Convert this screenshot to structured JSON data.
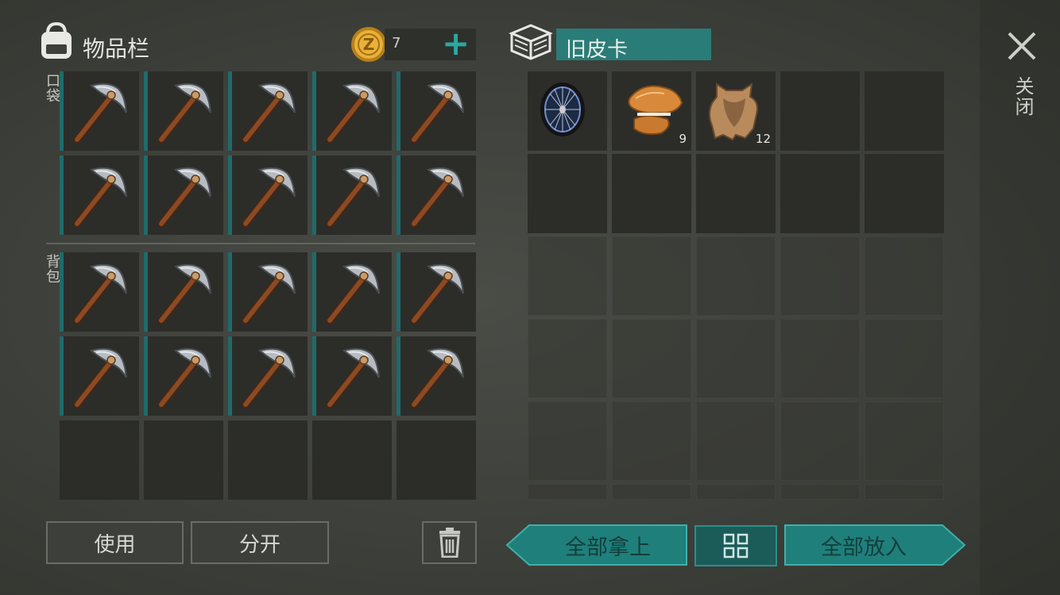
{
  "inventory": {
    "title": "物品栏",
    "pocket_label": "口袋",
    "backpack_label": "背包",
    "coin_count": "7",
    "add_symbol": "+",
    "item_name": "pickaxe"
  },
  "container": {
    "name": "旧皮卡",
    "items": [
      {
        "name": "wheel",
        "count": ""
      },
      {
        "name": "fox-fur",
        "count": "9"
      },
      {
        "name": "animal-hide",
        "count": "12"
      }
    ]
  },
  "actions": {
    "use_label": "使用",
    "split_label": "分开",
    "take_all_label": "全部拿上",
    "put_all_label": "全部放入",
    "close_label": "关闭"
  },
  "colors": {
    "accent_teal": "#2a8c88",
    "button_teal": "#1f7f7b",
    "slot_bg": "#2c2d29",
    "coin_gold": "#e0a628"
  }
}
